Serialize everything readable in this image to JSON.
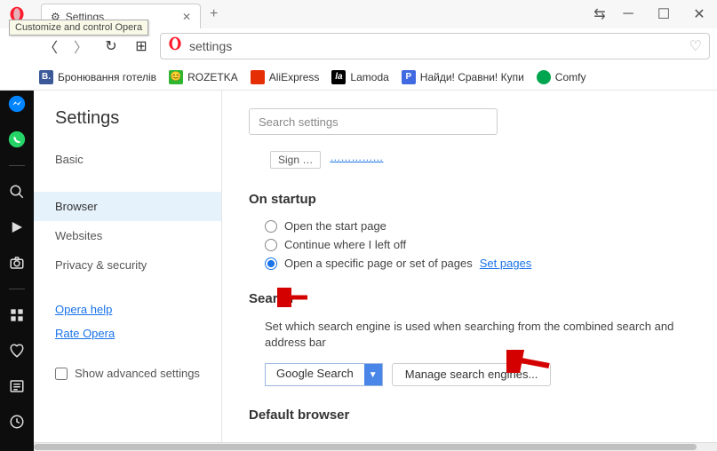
{
  "tooltip": "Customize and control Opera",
  "tab": {
    "title": "Settings"
  },
  "address": {
    "url": "settings"
  },
  "bookmarks": [
    {
      "label": "Бронювання готелів",
      "bg": "#3b5998",
      "letter": "B."
    },
    {
      "label": "ROZETKA",
      "bg": "#2fb52f",
      "emoji": "😊"
    },
    {
      "label": "AliExpress",
      "bg": "#e62e04",
      "letter": ""
    },
    {
      "label": "Lamoda",
      "bg": "#000",
      "letter": "la"
    },
    {
      "label": "Найди! Сравни! Купи",
      "bg": "#4169e1",
      "letter": "P"
    },
    {
      "label": "Comfy",
      "bg": "#00a54f",
      "letter": "●"
    }
  ],
  "sidebar": {
    "title": "Settings",
    "items": [
      "Basic",
      "Browser",
      "Websites",
      "Privacy & security"
    ],
    "selected_index": 1,
    "links": [
      "Opera help",
      "Rate Opera"
    ],
    "show_advanced": "Show advanced settings"
  },
  "content": {
    "search_placeholder": "Search settings",
    "truncated_btn": "Sign …",
    "truncated_link": "……………",
    "startup": {
      "heading": "On startup",
      "options": [
        "Open the start page",
        "Continue where I left off",
        "Open a specific page or set of pages"
      ],
      "selected_index": 2,
      "set_pages": "Set pages"
    },
    "search": {
      "heading": "Search",
      "desc": "Set which search engine is used when searching from the combined search and address bar",
      "engine": "Google Search",
      "manage": "Manage search engines..."
    },
    "default_browser": {
      "heading": "Default browser"
    }
  }
}
